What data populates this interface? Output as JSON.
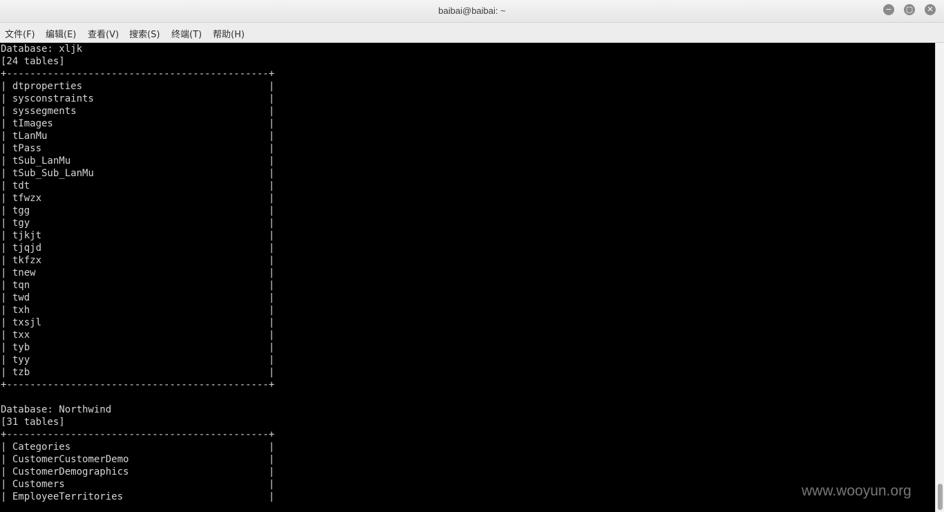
{
  "window": {
    "title": "baibai@baibai: ~",
    "controls": [
      {
        "name": "minimize-button",
        "glyph": "−"
      },
      {
        "name": "maximize-button",
        "glyph": "▢"
      },
      {
        "name": "close-button",
        "glyph": "✕"
      }
    ]
  },
  "menu": [
    "文件(F)",
    "编辑(E)",
    "查看(V)",
    "搜索(S)",
    "终端(T)",
    "帮助(H)"
  ],
  "terminal": {
    "lines": [
      "Database: xljk",
      "[24 tables]",
      "+---------------------------------------------+",
      "| dtproperties                                |",
      "| sysconstraints                              |",
      "| syssegments                                 |",
      "| tImages                                     |",
      "| tLanMu                                      |",
      "| tPass                                       |",
      "| tSub_LanMu                                  |",
      "| tSub_Sub_LanMu                              |",
      "| tdt                                         |",
      "| tfwzx                                       |",
      "| tgg                                         |",
      "| tgy                                         |",
      "| tjkjt                                       |",
      "| tjqjd                                       |",
      "| tkfzx                                       |",
      "| tnew                                        |",
      "| tqn                                         |",
      "| twd                                         |",
      "| txh                                         |",
      "| txsjl                                       |",
      "| txx                                         |",
      "| tyb                                         |",
      "| tyy                                         |",
      "| tzb                                         |",
      "+---------------------------------------------+",
      "",
      "Database: Northwind",
      "[31 tables]",
      "+---------------------------------------------+",
      "| Categories                                  |",
      "| CustomerCustomerDemo                        |",
      "| CustomerDemographics                        |",
      "| Customers                                   |",
      "| EmployeeTerritories                         |"
    ]
  },
  "watermark": "www.wooyun.org",
  "colors": {
    "terminal_bg": "#000000",
    "terminal_fg": "#d6d6d6",
    "titlebar_bg": "#ececec"
  }
}
